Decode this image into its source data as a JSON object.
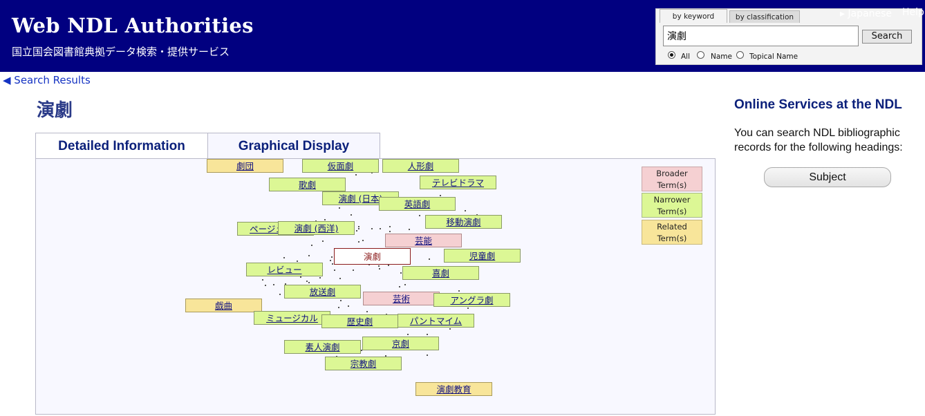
{
  "header": {
    "site_title": "Web NDL Authorities",
    "site_subtitle": "国立国会図書館典拠データ検索・提供サービス",
    "language_link": "▸ Japanese",
    "help_link": "Help",
    "background_color": "#010080"
  },
  "search": {
    "tab_keyword": "by keyword",
    "tab_classification": "by classification",
    "query_value": "演劇",
    "button_label": "Search",
    "options": [
      {
        "label": "All",
        "checked": true
      },
      {
        "label": "Name",
        "checked": false
      },
      {
        "label": "Topical Name",
        "checked": false
      }
    ]
  },
  "nav": {
    "back_link": "◀ Search Results"
  },
  "page_title": "演劇",
  "tabs": {
    "detail": "Detailed Information",
    "graph": "Graphical Display"
  },
  "graph": {
    "center_term": "演劇",
    "narrower_terms": [
      "仮面劇",
      "人形劇",
      "歌劇",
      "テレビドラマ",
      "演劇 (日本)",
      "英語劇",
      "移動演劇",
      "ページェント",
      "演劇 (西洋)",
      "児童劇",
      "レビュー",
      "喜劇",
      "放送劇",
      "アングラ劇",
      "ミュージカル",
      "歴史劇",
      "パントマイム",
      "素人演劇",
      "京劇",
      "宗教劇"
    ],
    "broader_terms": [
      "芸能",
      "芸術"
    ],
    "related_terms": [
      "劇団",
      "戯曲",
      "演劇教育"
    ],
    "colors": {
      "narrower": "#dcf795",
      "broader": "#f5d0d2",
      "related": "#f8e59a",
      "center_border": "#8a1a1a"
    }
  },
  "legend": {
    "broader": "Broader Term(s)",
    "narrower": "Narrower Term(s)",
    "related": "Related Term(s)"
  },
  "sidebar": {
    "title": "Online Services at the NDL",
    "text": "You can search NDL bibliographic records for the following headings:",
    "subject_button": "Subject"
  }
}
